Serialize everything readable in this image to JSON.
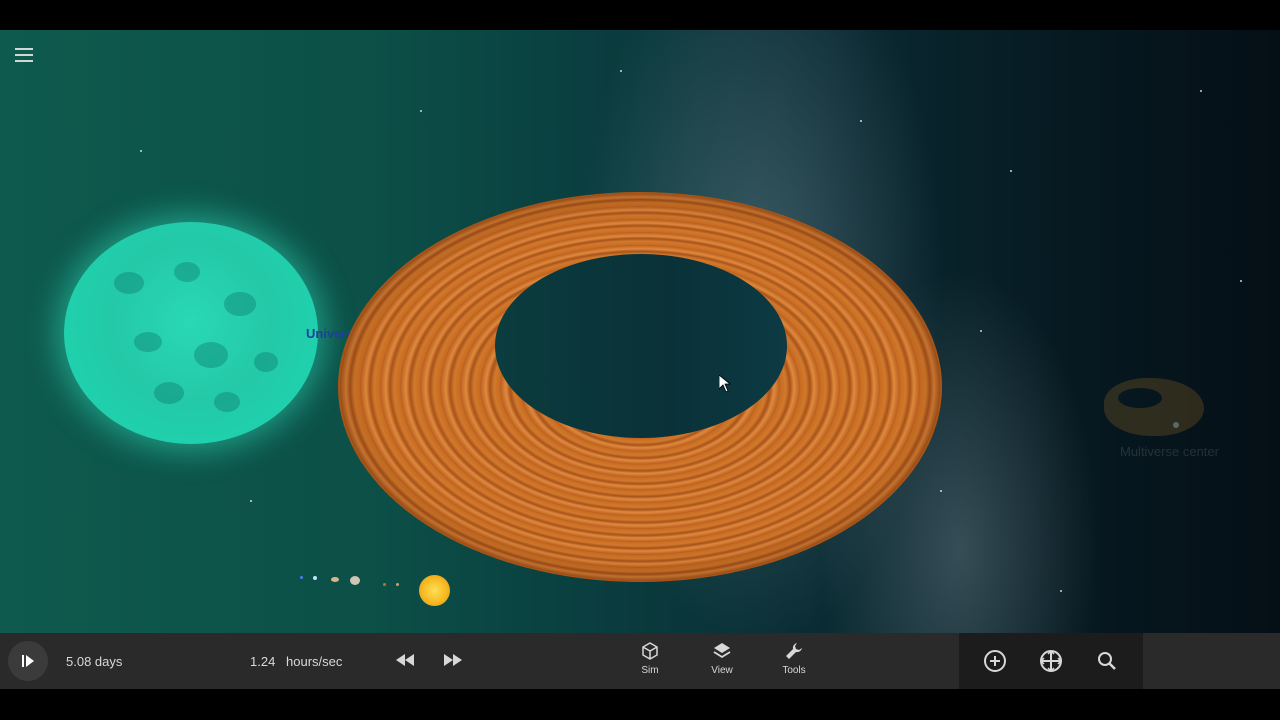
{
  "viewport": {
    "object_label": "Universe",
    "minimap_label": "Multiverse center"
  },
  "menu": {
    "icon": "hamburger-menu-icon"
  },
  "bottom_bar": {
    "play_icon": "play-icon",
    "elapsed_time": "5.08 days",
    "speed_value": "1.24",
    "speed_unit": "hours/sec",
    "rewind_icon": "rewind-icon",
    "fast_forward_icon": "fast-forward-icon",
    "tools": [
      {
        "label": "Sim",
        "icon": "cube-icon"
      },
      {
        "label": "View",
        "icon": "layers-icon"
      },
      {
        "label": "Tools",
        "icon": "wrench-icon"
      }
    ],
    "right_actions": [
      {
        "icon": "add-object-icon"
      },
      {
        "icon": "move-target-icon"
      },
      {
        "icon": "search-icon"
      }
    ]
  },
  "colors": {
    "bar_bg": "#2a2a2a",
    "star": "#2ad8b6",
    "torus": "#c96a1f",
    "label": "#1e3f9c"
  }
}
